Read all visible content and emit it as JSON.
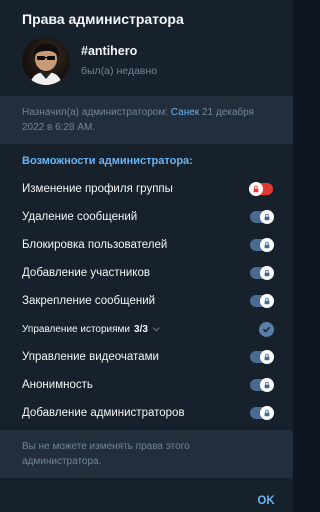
{
  "dialog": {
    "title": "Права администратора",
    "user": {
      "name": "#antihero",
      "status": "был(а) недавно"
    },
    "info": {
      "prefix": "Назначил(а) администратором: ",
      "appointer": "Санек",
      "date": " 21 декабря 2022 в 6:28 AM."
    },
    "section_title": "Возможности администратора:",
    "permissions": [
      {
        "label": "Изменение профиля группы",
        "state": "off",
        "locked": true
      },
      {
        "label": "Удаление сообщений",
        "state": "on",
        "locked": true
      },
      {
        "label": "Блокировка пользователей",
        "state": "on",
        "locked": true
      },
      {
        "label": "Добавление участников",
        "state": "on",
        "locked": true
      },
      {
        "label": "Закрепление сообщений",
        "state": "on",
        "locked": true
      },
      {
        "label": "Управление историями",
        "count": "3/3",
        "chevron": "chevron-down-icon",
        "state": "checked"
      },
      {
        "label": "Управление видеочатами",
        "state": "on",
        "locked": true
      },
      {
        "label": "Анонимность",
        "state": "on",
        "locked": true
      },
      {
        "label": "Добавление администраторов",
        "state": "on",
        "locked": true
      }
    ],
    "note": "Вы не можете изменять права этого администратора.",
    "ok_label": "OK"
  },
  "colors": {
    "background": "#17212b",
    "panel": "#232e3c",
    "accent": "#6ab3f3",
    "muted": "#708499",
    "toggle_on": "#4a6a90",
    "toggle_off": "#e53935"
  }
}
